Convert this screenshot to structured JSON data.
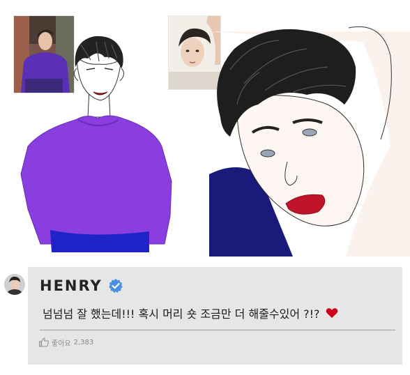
{
  "comment": {
    "username": "HENRY",
    "text": "넘넘넘 잘 했는데!!! 혹시 머리 숏 조금만 더 해줄수있어 ?!?",
    "like_label": "좋아요",
    "like_count": "2,383"
  },
  "icons": {
    "verified": "verified-badge-icon",
    "heart": "heart-icon",
    "like": "thumbs-up-icon"
  },
  "colors": {
    "card_background": "#e6e6e6",
    "verified_badge": "#4a90e2",
    "heart": "#d0021b",
    "sweater_purple": "#8a3ee0",
    "navy_shirt": "#1a1a7a"
  }
}
